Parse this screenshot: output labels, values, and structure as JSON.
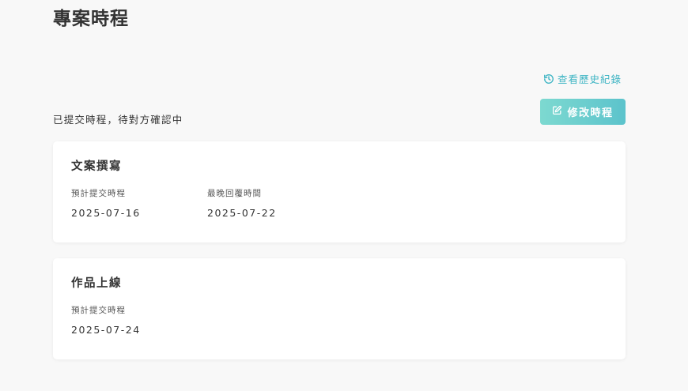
{
  "page": {
    "title": "專案時程"
  },
  "actions": {
    "history_label": "查看歷史紀錄",
    "edit_label": "修改時程"
  },
  "status": {
    "text": "已提交時程，待對方確認中"
  },
  "milestones": [
    {
      "title": "文案撰寫",
      "fields": [
        {
          "label": "預計提交時程",
          "value": "2025-07-16"
        },
        {
          "label": "最晚回覆時間",
          "value": "2025-07-22"
        }
      ]
    },
    {
      "title": "作品上線",
      "fields": [
        {
          "label": "預計提交時程",
          "value": "2025-07-24"
        }
      ]
    }
  ],
  "icons": {
    "history": "history-icon",
    "edit": "edit-icon"
  },
  "colors": {
    "accent": "#3fb5c4",
    "button_start": "#7dd9d0",
    "button_end": "#5cc3cc",
    "background": "#f8f8f8"
  }
}
